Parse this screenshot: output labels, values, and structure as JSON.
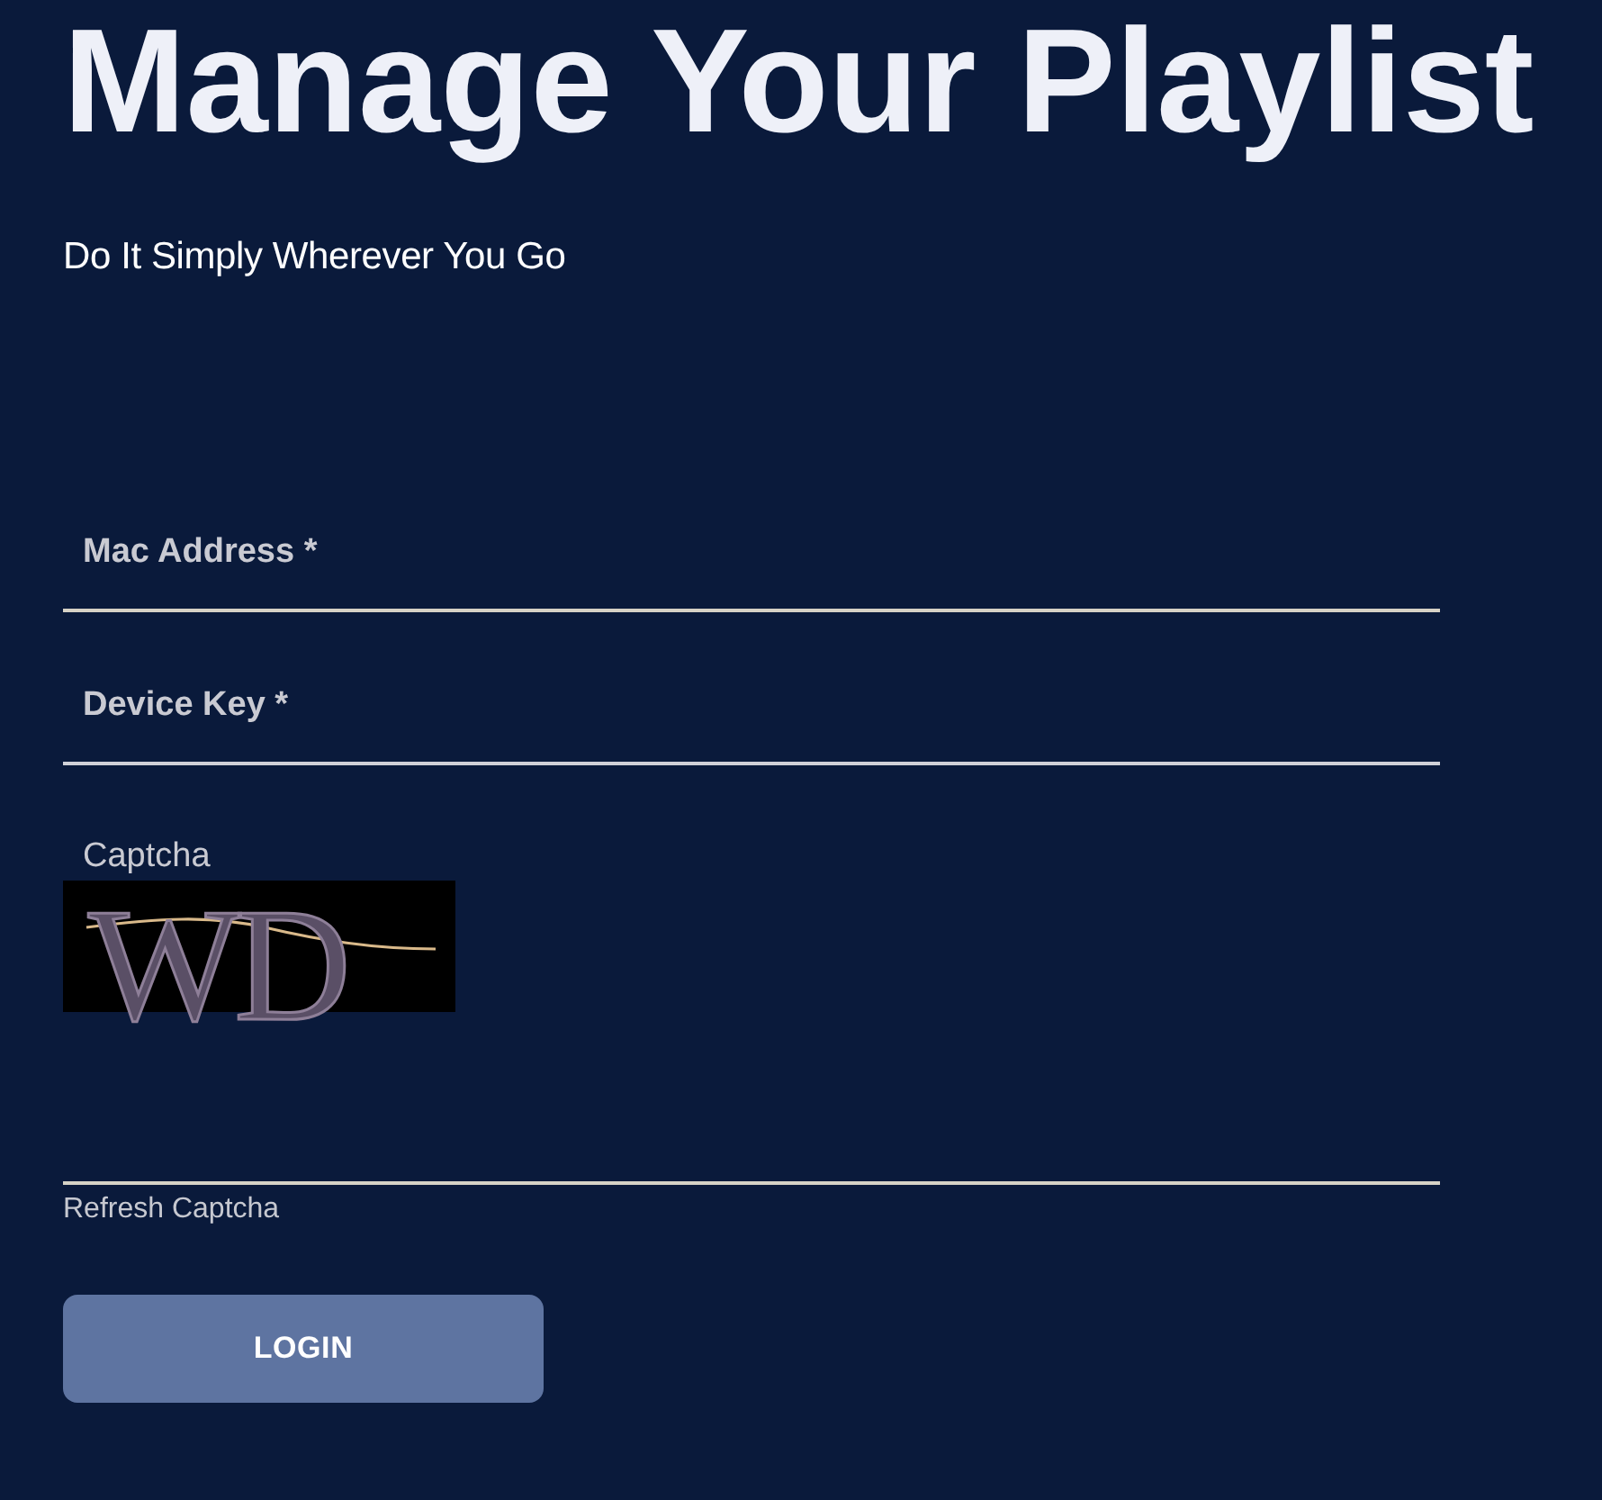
{
  "heading": {
    "title": "Manage Your Playlist",
    "subtitle": "Do It Simply Wherever You Go"
  },
  "form": {
    "fields": [
      {
        "placeholder": "Mac Address *"
      },
      {
        "placeholder": "Device Key *"
      }
    ],
    "captcha": {
      "label": "Captcha",
      "code": "WD"
    },
    "refresh_link": "Refresh Captcha",
    "submit_button": "LOGIN"
  }
}
